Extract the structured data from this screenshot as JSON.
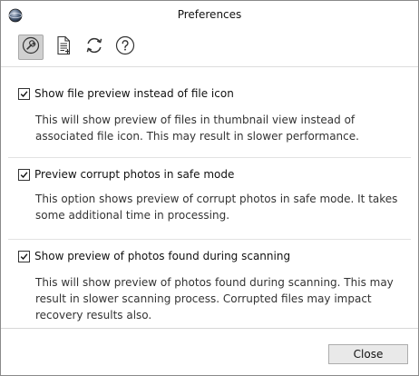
{
  "window": {
    "title": "Preferences",
    "app_icon": "app-globe-icon"
  },
  "toolbar": {
    "items": [
      {
        "name": "settings",
        "icon": "wrench-icon",
        "selected": true
      },
      {
        "name": "file-preview",
        "icon": "document-icon",
        "selected": false
      },
      {
        "name": "update",
        "icon": "refresh-icon",
        "selected": false
      },
      {
        "name": "help",
        "icon": "help-icon",
        "selected": false
      }
    ]
  },
  "options": [
    {
      "label": "Show file preview instead of file icon",
      "checked": true,
      "description": "This will show preview of files in thumbnail view instead of associated file icon. This may result in slower performance."
    },
    {
      "label": "Preview corrupt photos in safe mode",
      "checked": true,
      "description": "This option shows preview of corrupt photos in safe mode. It takes some additional time in processing."
    },
    {
      "label": "Show preview of photos found during scanning",
      "checked": true,
      "description": "This will show preview of photos found during scanning. This may result in slower scanning process. Corrupted files may impact recovery results also."
    }
  ],
  "footer": {
    "close_label": "Close"
  }
}
